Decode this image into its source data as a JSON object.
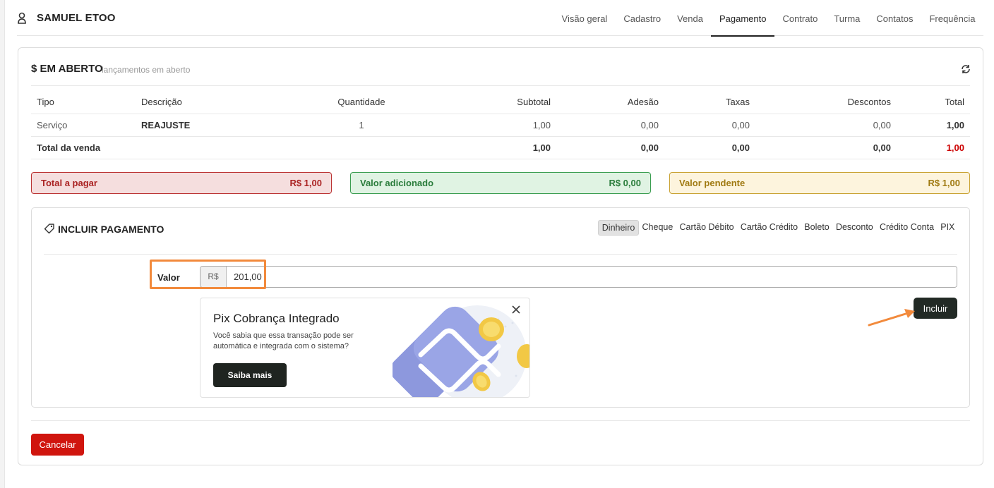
{
  "header": {
    "title": "SAMUEL ETOO",
    "tabs": [
      {
        "label": "Visão geral"
      },
      {
        "label": "Cadastro"
      },
      {
        "label": "Venda"
      },
      {
        "label": "Pagamento",
        "active": true
      },
      {
        "label": "Contrato"
      },
      {
        "label": "Turma"
      },
      {
        "label": "Contatos"
      },
      {
        "label": "Frequência"
      }
    ]
  },
  "em_aberto": {
    "title": "$ EM ABERTO",
    "subtitle": "lançamentos em aberto",
    "columns": [
      "Tipo",
      "Descrição",
      "Quantidade",
      "Subtotal",
      "Adesão",
      "Taxas",
      "Descontos",
      "Total"
    ],
    "row": {
      "tipo": "Serviço",
      "descricao": "REAJUSTE",
      "quantidade": "1",
      "subtotal": "1,00",
      "adesao": "0,00",
      "taxas": "0,00",
      "descontos": "0,00",
      "total": "1,00"
    },
    "total_row": {
      "label": "Total da venda",
      "subtotal": "1,00",
      "adesao": "0,00",
      "taxas": "0,00",
      "descontos": "0,00",
      "total": "1,00"
    }
  },
  "summary": {
    "total_a_pagar": {
      "label": "Total a pagar",
      "value": "R$ 1,00"
    },
    "valor_adicionado": {
      "label": "Valor adicionado",
      "value": "R$ 0,00"
    },
    "valor_pendente": {
      "label": "Valor pendente",
      "value": "R$ 1,00"
    }
  },
  "payment": {
    "title": "INCLUIR PAGAMENTO",
    "methods": [
      "Dinheiro",
      "Cheque",
      "Cartão Débito",
      "Cartão Crédito",
      "Boleto",
      "Desconto",
      "Crédito Conta",
      "PIX"
    ],
    "active_method": "Dinheiro",
    "valor_label": "Valor",
    "currency_prefix": "R$",
    "valor_value": "201,00",
    "include_label": "Incluir"
  },
  "promo": {
    "title": "Pix Cobrança Integrado",
    "text": "Você sabia que essa transação pode ser automática e integrada com o sistema?",
    "button": "Saiba mais"
  },
  "footer": {
    "cancel_label": "Cancelar"
  },
  "colors": {
    "accent_highlight": "#f28a3c",
    "cancel": "#d0150e",
    "dark_button": "#222a25"
  }
}
